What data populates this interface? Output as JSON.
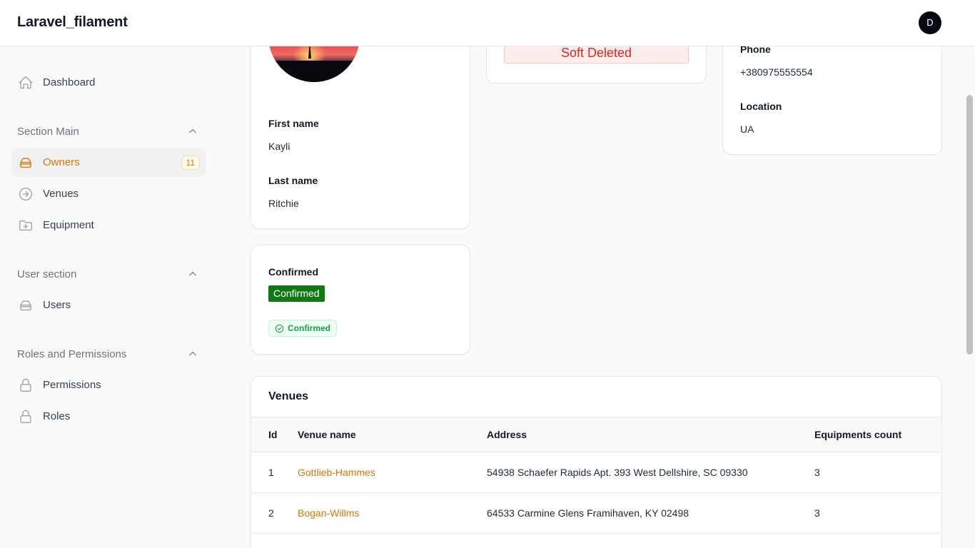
{
  "app": {
    "title": "Laravel_filament",
    "user_initial": "D"
  },
  "sidebar": {
    "dashboard": {
      "label": "Dashboard",
      "icon": "home-icon"
    },
    "groups": [
      {
        "label": "Section Main",
        "items": [
          {
            "label": "Owners",
            "icon": "inbox-stack-icon",
            "badge": "11",
            "active": true
          },
          {
            "label": "Venues",
            "icon": "arrow-circle-right-icon"
          },
          {
            "label": "Equipment",
            "icon": "folder-plus-icon"
          }
        ]
      },
      {
        "label": "User section",
        "items": [
          {
            "label": "Users",
            "icon": "inbox-stack-icon"
          }
        ]
      },
      {
        "label": "Roles and Permissions",
        "items": [
          {
            "label": "Permissions",
            "icon": "lock-icon"
          },
          {
            "label": "Roles",
            "icon": "lock-icon"
          }
        ]
      }
    ]
  },
  "profile": {
    "first_name_label": "First name",
    "first_name": "Kayli",
    "last_name_label": "Last name",
    "last_name": "Ritchie"
  },
  "status": {
    "soft_deleted": "Soft Deleted"
  },
  "contact": {
    "phone_label": "Phone",
    "phone": "+380975555554",
    "location_label": "Location",
    "location": "UA"
  },
  "confirmation": {
    "label": "Confirmed",
    "pill": "Confirmed",
    "chip": "Confirmed"
  },
  "venues": {
    "title": "Venues",
    "columns": [
      "Id",
      "Venue name",
      "Address",
      "Equipments count"
    ],
    "rows": [
      {
        "id": "1",
        "name": "Gottlieb-Hammes",
        "address": "54938 Schaefer Rapids Apt. 393 West Dellshire, SC 09330",
        "count": "3"
      },
      {
        "id": "2",
        "name": "Bogan-Willms",
        "address": "64533 Carmine Glens Framihaven, KY 02498",
        "count": "3"
      }
    ]
  },
  "colors": {
    "accent": "#d97706",
    "danger": "#dc2626",
    "success": "#16a34a",
    "confirmed_pill": "#0f7a12"
  }
}
